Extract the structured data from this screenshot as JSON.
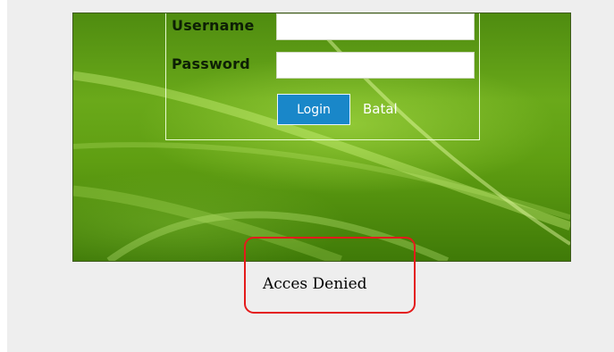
{
  "login_form": {
    "username_label": "Username",
    "password_label": "Password",
    "username_value": "",
    "password_value": "",
    "login_label": "Login",
    "cancel_label": "Batal"
  },
  "status": {
    "message": "Acces Denied"
  },
  "colors": {
    "page_background": "#eeeeee",
    "panel_green": "#5f9e12",
    "login_button": "#1987c9",
    "highlight_border": "#e41b1b"
  }
}
